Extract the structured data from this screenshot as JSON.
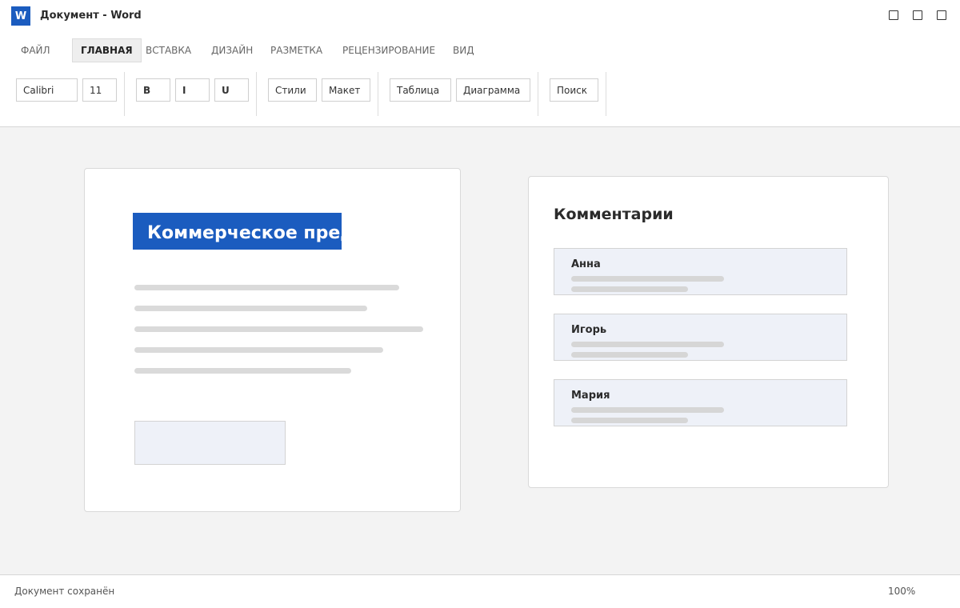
{
  "app": {
    "icon_letter": "W",
    "window_title": "Документ - Word"
  },
  "ribbon": {
    "tabs": [
      {
        "label": "ФАЙЛ",
        "active": false
      },
      {
        "label": "ГЛАВНАЯ",
        "active": true
      },
      {
        "label": "ВСТАВКА",
        "active": false
      },
      {
        "label": "ДИЗАЙН",
        "active": false
      },
      {
        "label": "РАЗМЕТКА",
        "active": false
      },
      {
        "label": "РЕЦЕНЗИРОВАНИЕ",
        "active": false
      },
      {
        "label": "ВИД",
        "active": false
      }
    ]
  },
  "toolbar": {
    "font_name": "Calibri",
    "font_size": "11",
    "bold": "B",
    "italic": "I",
    "underline": "U",
    "styles": "Стили",
    "layout": "Макет",
    "table": "Таблица",
    "chart": "Диаграмма",
    "search": "Поиск"
  },
  "document": {
    "heading": "Коммерческое предложение"
  },
  "comments": {
    "title": "Комментарии",
    "items": [
      {
        "author": "Анна"
      },
      {
        "author": "Игорь"
      },
      {
        "author": "Мария"
      }
    ]
  },
  "status": {
    "text": "Документ сохранён",
    "zoom": "100%"
  },
  "colors": {
    "accent": "#1b5cbf",
    "comment_bg": "#eef1f8",
    "workspace_bg": "#f3f3f3"
  }
}
